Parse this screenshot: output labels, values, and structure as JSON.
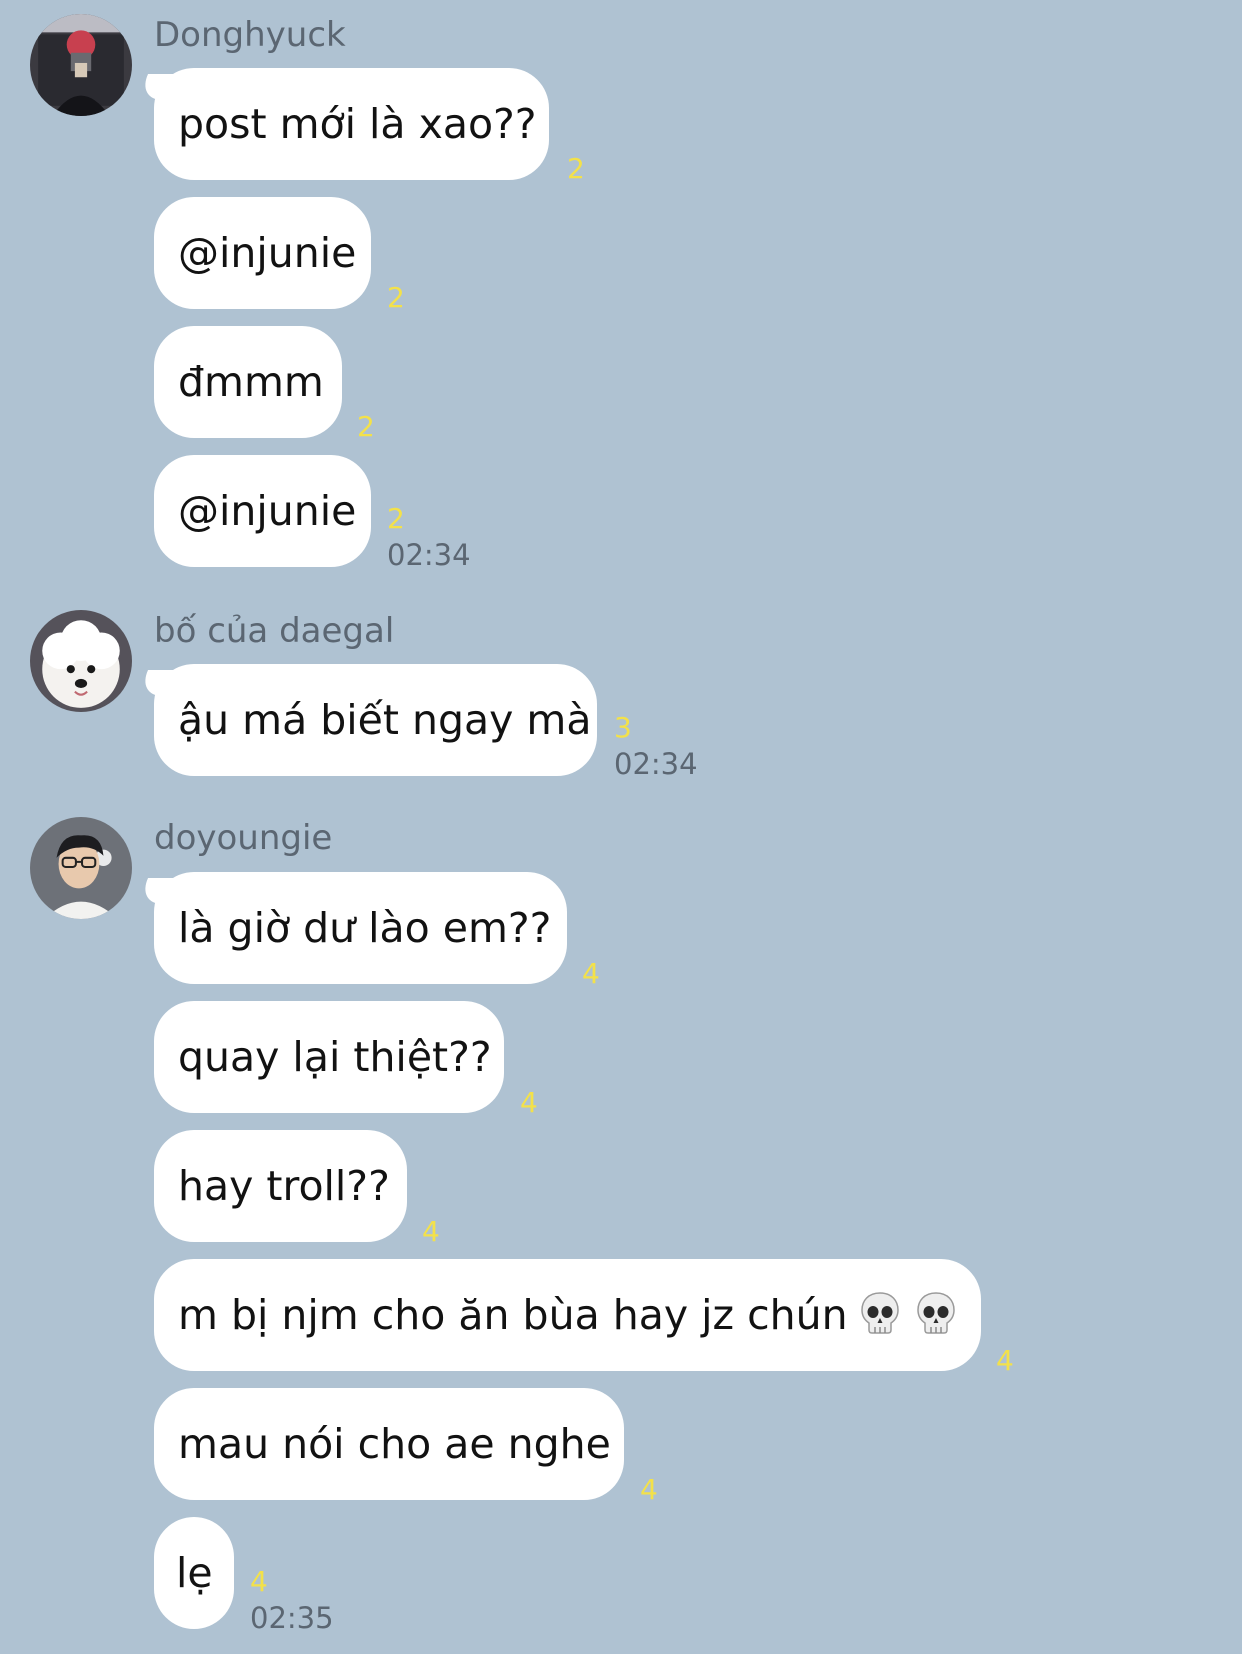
{
  "chat": {
    "groups": [
      {
        "sender": "Donghyuck",
        "avatar_icon": "avatar-red-hair-mirror-selfie",
        "messages": [
          {
            "text": "post mới là xao??",
            "unread": "2"
          },
          {
            "text": "@injunie",
            "unread": "2"
          },
          {
            "text": "đmmm",
            "unread": "2"
          },
          {
            "text": "@injunie",
            "unread": "2"
          }
        ],
        "time": "02:34"
      },
      {
        "sender": "bố của daegal",
        "avatar_icon": "avatar-white-dog",
        "messages": [
          {
            "text": "ậu má biết ngay mà",
            "unread": "3"
          }
        ],
        "time": "02:34"
      },
      {
        "sender": "doyoungie",
        "avatar_icon": "avatar-person-glasses",
        "messages": [
          {
            "text": "là giờ dư lào em??",
            "unread": "4"
          },
          {
            "text": "quay lại thiệt??",
            "unread": "4"
          },
          {
            "text": "hay troll??",
            "unread": "4"
          },
          {
            "text": "m bị njm cho ăn bùa hay jz chún",
            "emoji": [
              "skull-emoji",
              "skull-emoji"
            ],
            "unread": "4"
          },
          {
            "text": "mau nói cho ae nghe",
            "unread": "4"
          },
          {
            "text": "lẹ",
            "unread": "4"
          }
        ],
        "time": "02:35"
      }
    ]
  },
  "colors": {
    "background": "#afc2d2",
    "bubble": "#ffffff",
    "unread_count": "#f3e14a",
    "meta_text": "#5b6672"
  }
}
